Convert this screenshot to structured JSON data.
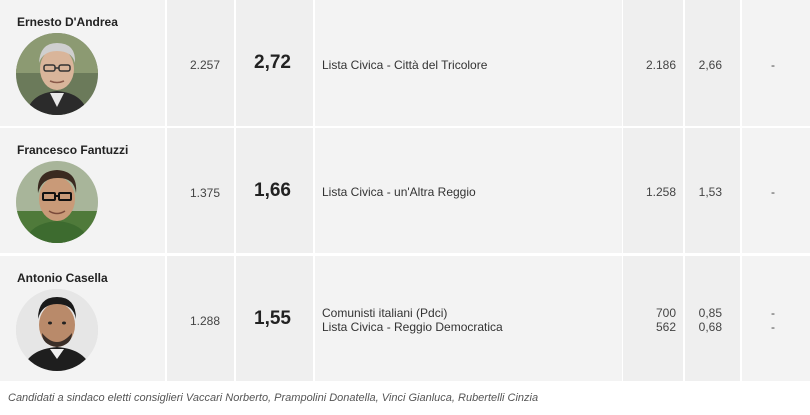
{
  "candidates": [
    {
      "name": "Ernesto D'Andrea",
      "votes": "2.257",
      "percent": "2,72",
      "lists": [
        {
          "name": "Lista Civica - Città del Tricolore",
          "votes": "2.186",
          "percent": "2,66",
          "seats": "-"
        }
      ]
    },
    {
      "name": "Francesco Fantuzzi",
      "votes": "1.375",
      "percent": "1,66",
      "lists": [
        {
          "name": "Lista Civica - un'Altra Reggio",
          "votes": "1.258",
          "percent": "1,53",
          "seats": "-"
        }
      ]
    },
    {
      "name": "Antonio Casella",
      "votes": "1.288",
      "percent": "1,55",
      "lists": [
        {
          "name": "Comunisti italiani (Pdci)",
          "votes": "700",
          "percent": "0,85",
          "seats": "-"
        },
        {
          "name": "Lista Civica - Reggio Democratica",
          "votes": "562",
          "percent": "0,68",
          "seats": "-"
        }
      ]
    }
  ],
  "footer_note": "Candidati a sindaco eletti consiglieri Vaccari Norberto, Prampolini Donatella, Vinci Gianluca, Rubertelli Cinzia"
}
